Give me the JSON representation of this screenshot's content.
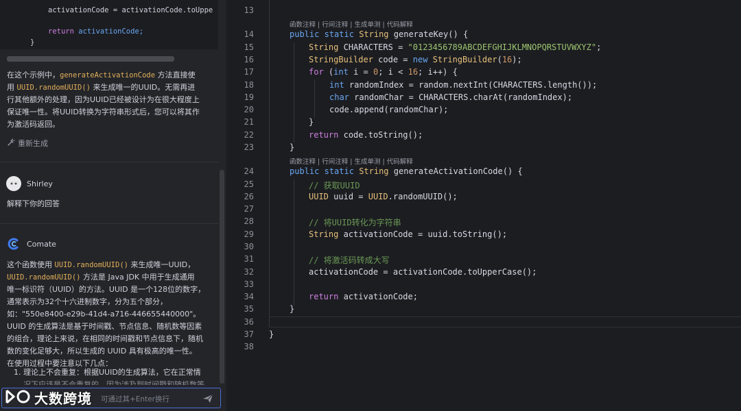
{
  "chat": {
    "code_snippet": [
      "activationCode = activationCode.toUppe",
      "",
      "return activationCode;",
      "}"
    ],
    "explanation": {
      "t1": "在这个示例中，",
      "m1": "generateActivationCode",
      "t2": " 方法直接使",
      "t3": "用 ",
      "m2": "UUID.randomUUID()",
      "t4": " 来生成唯一的UUID。无需再进",
      "t5": "行其他额外的处理，因为UUID已经被设计为在很大程度上",
      "t6": "保证唯一性。将UUID转换为字符串形式后，您可以将其作",
      "t7": "为激活码返回。"
    },
    "regenerate_label": "重新生成",
    "user": {
      "name": "Shirley",
      "message": "解释下你的回答"
    },
    "assistant": {
      "name": "Comate",
      "l1a": "这个函数使用 ",
      "l1m": "UUID.randomUUID()",
      "l1b": " 来生成唯一UUID，",
      "l2m": "UUID.randomUUID()",
      "l2b": " 方法是 Java JDK 中用于生成通用",
      "l3": "唯一标识符（UUID）的方法。UUID 是一个128位的数字，",
      "l4": "通常表示为32个十六进制数字，分为五个部分，",
      "l5": "如：\"550e8400-e29b-41d4-a716-446655440000\"。",
      "l6": "UUID 的生成算法是基于时间戳、节点信息、随机数等因素",
      "l7": "的组合，理论上来说，在相同的时间戳和节点信息下，随机",
      "l8": "数的变化足够大，所以生成的 UUID 具有极高的唯一性。",
      "l9": "在使用过程中要注意以下几点：",
      "item1": "1. 理论上不会重复：根据UUID的生成算法，它在正常情",
      "item1_cont": "况下应该是不会重复的，因为涉及到时间戳和随机数等"
    },
    "input_placeholder": "可通过其+Enter换行",
    "watermark": "大数跨境"
  },
  "editor": {
    "code_lens": "函数注释 | 行间注释 | 生成单测 | 代码解释",
    "line_numbers": [
      "13",
      "14",
      "15",
      "16",
      "17",
      "18",
      "19",
      "20",
      "21",
      "22",
      "23",
      "24",
      "25",
      "26",
      "27",
      "28",
      "29",
      "30",
      "31",
      "32",
      "33",
      "34",
      "35",
      "36",
      "37",
      "38"
    ],
    "lines": {
      "l14": [
        "public",
        "static",
        "String",
        "generateKey",
        "() {"
      ],
      "l15": [
        "String",
        "CHARACTERS",
        " = ",
        "\"0123456789ABCDEFGHIJKLMNOPQRSTUVWXYZ\"",
        ";"
      ],
      "l16": [
        "StringBuilder",
        "code",
        " = ",
        "new",
        "StringBuilder",
        "(",
        "16",
        ");"
      ],
      "l17": [
        "for",
        " (",
        "int",
        "i",
        " = ",
        "0",
        "; ",
        "i",
        " < ",
        "16",
        "; ",
        "i",
        "++) {"
      ],
      "l18": [
        "int",
        "randomIndex",
        " = ",
        "random",
        ".nextInt(",
        "CHARACTERS",
        ".length());"
      ],
      "l19": [
        "char",
        "randomChar",
        " = ",
        "CHARACTERS",
        ".charAt(",
        "randomIndex",
        ");"
      ],
      "l20": [
        "code",
        ".append(",
        "randomChar",
        ");"
      ],
      "l21": "}",
      "l22": [
        "return",
        "code",
        ".toString();"
      ],
      "l23": "}",
      "l24": [
        "public",
        "static",
        "String",
        "generateActivationCode",
        "() {"
      ],
      "l25": "// 获取UUID",
      "l26": [
        "UUID",
        "uuid",
        " = ",
        "UUID",
        ".randomUUID();"
      ],
      "l28": "// 将UUID转化为字符串",
      "l29": [
        "String",
        "activationCode",
        " = ",
        "uuid",
        ".toString();"
      ],
      "l31": "// 将激活码转成大写",
      "l32": [
        "activationCode",
        " = ",
        "activationCode",
        ".toUpperCase();"
      ],
      "l34": [
        "return",
        "activationCode",
        ";"
      ],
      "l35": "}",
      "l37": "}"
    }
  },
  "colors": {
    "keyword": "#cc7fe0",
    "type": "#e6c07b",
    "string": "#9dc56f",
    "number": "#d19a66",
    "comment": "#6a9955",
    "accent": "#4a6fd6"
  },
  "icons": [
    "regenerate-icon",
    "user-avatar-icon",
    "comate-logo-icon",
    "send-icon",
    "watermark-logo-icon"
  ]
}
